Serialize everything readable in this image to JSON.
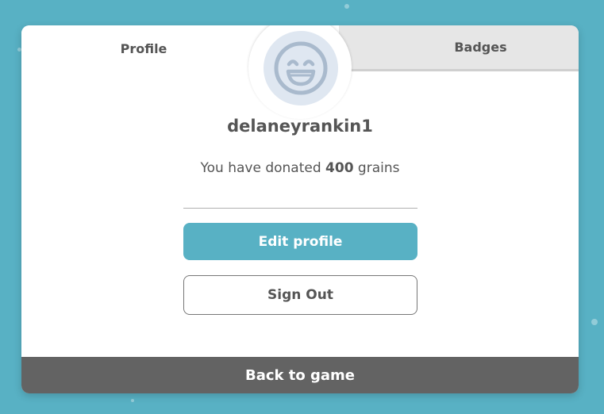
{
  "colors": {
    "background": "#58b1c4",
    "accent": "#58b1c4",
    "footer": "#636363",
    "avatar_bg": "#dfe7f1",
    "avatar_stroke": "#a9bacd"
  },
  "tabs": {
    "profile_label": "Profile",
    "badges_label": "Badges",
    "active": "Profile"
  },
  "profile": {
    "avatar_icon": "smiley-face-icon",
    "username": "delaneyrankin1",
    "donated_prefix": "You have donated ",
    "donated_amount": "400",
    "donated_suffix": " grains"
  },
  "actions": {
    "edit_profile_label": "Edit profile",
    "sign_out_label": "Sign Out"
  },
  "footer": {
    "back_label": "Back to game"
  }
}
